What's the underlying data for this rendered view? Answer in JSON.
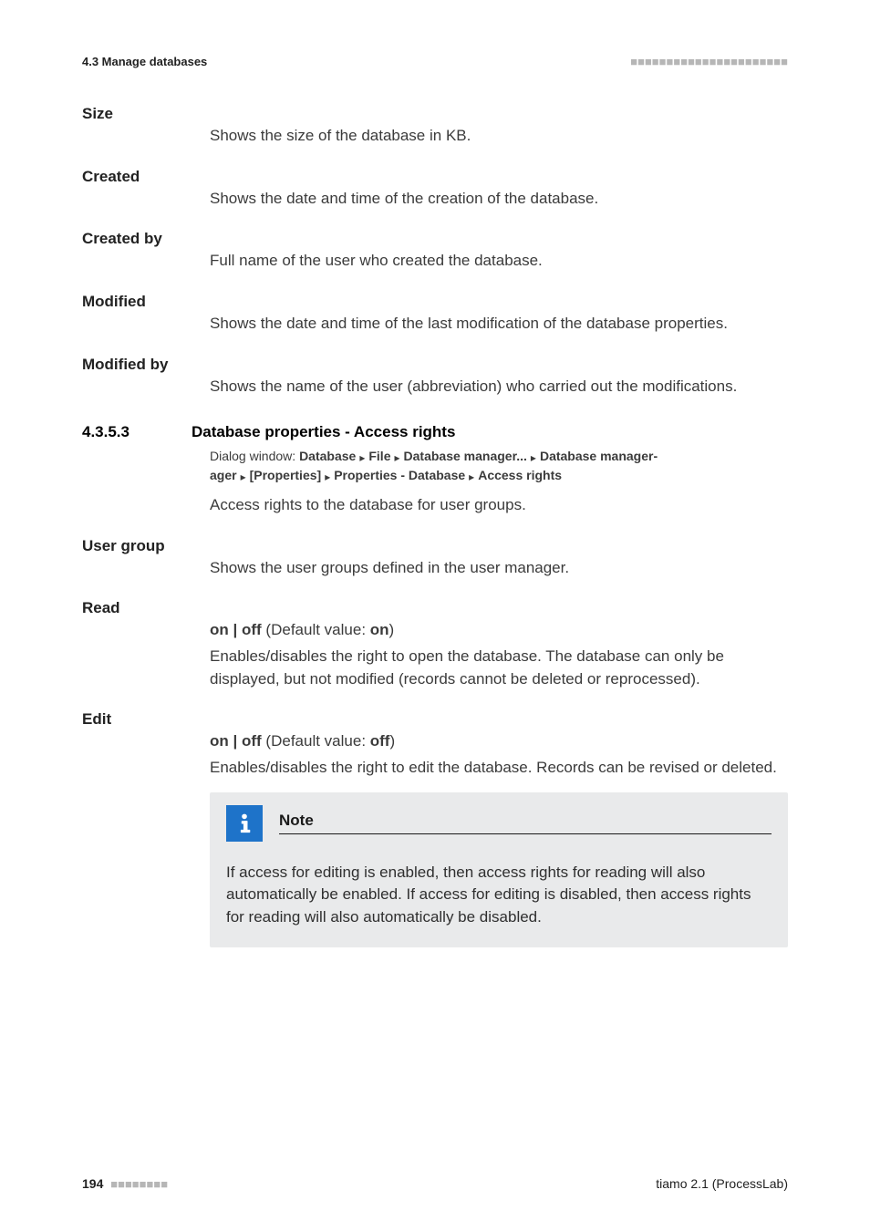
{
  "header": {
    "section_ref": "4.3 Manage databases",
    "tick_pattern": "■■■■■■■■■■■■■■■■■■■■■■"
  },
  "terms": {
    "size": {
      "label": "Size",
      "desc": "Shows the size of the database in KB."
    },
    "created": {
      "label": "Created",
      "desc": "Shows the date and time of the creation of the database."
    },
    "created_by": {
      "label": "Created by",
      "desc": "Full name of the user who created the database."
    },
    "modified": {
      "label": "Modified",
      "desc": "Shows the date and time of the last modification of the database properties."
    },
    "modified_by": {
      "label": "Modified by",
      "desc": "Shows the name of the user (abbreviation) who carried out the modifications."
    }
  },
  "subsection": {
    "number": "4.3.5.3",
    "title": "Database properties - Access rights",
    "dialog_lead": "Dialog window: ",
    "path": {
      "p1": "Database",
      "p2": "File",
      "p3": "Database manager...",
      "p4": "Database manager",
      "p5": "[Properties]",
      "p6": "Properties - Database",
      "p7": "Access rights"
    },
    "intro": "Access rights to the database for user groups."
  },
  "user_group": {
    "label": "User group",
    "desc": "Shows the user groups defined in the user manager."
  },
  "read": {
    "label": "Read",
    "on": "on",
    "sep": " | ",
    "off": "off",
    "default_lead": " (Default value: ",
    "default_val": "on",
    "default_tail": ")",
    "desc": "Enables/disables the right to open the database. The database can only be displayed, but not modified (records cannot be deleted or reprocessed)."
  },
  "edit": {
    "label": "Edit",
    "on": "on",
    "sep": " | ",
    "off": "off",
    "default_lead": " (Default value: ",
    "default_val": "off",
    "default_tail": ")",
    "desc": "Enables/disables the right to edit the database. Records can be revised or deleted."
  },
  "note": {
    "title": "Note",
    "body": "If access for editing is enabled, then access rights for reading will also automatically be enabled. If access for editing is disabled, then access rights for reading will also automatically be disabled."
  },
  "footer": {
    "page": "194",
    "tick_pattern": "■■■■■■■■",
    "right": "tiamo 2.1 (ProcessLab)"
  },
  "glyphs": {
    "caret": "▸"
  }
}
